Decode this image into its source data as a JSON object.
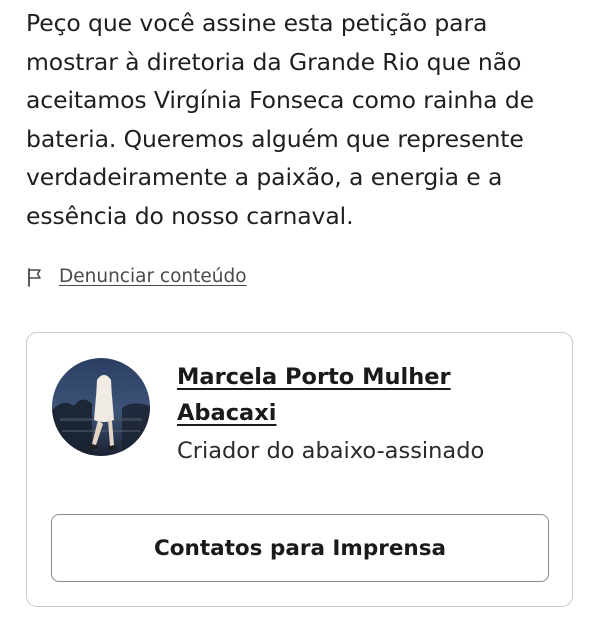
{
  "petition": {
    "body_text": "Peço que você assine esta petição para mostrar à diretoria da Grande Rio que não aceitamos Virgínia Fonseca como rainha de bateria. Queremos alguém que represente verdadeiramente a paixão, a energia e a essência do nosso carnaval."
  },
  "report": {
    "icon": "flag-icon",
    "label": "Denunciar conteúdo"
  },
  "creator": {
    "name": "Marcela Porto Mulher Abacaxi",
    "role": "Criador do abaixo-assinado",
    "avatar": "user-avatar-photo"
  },
  "press_button": {
    "label": "Contatos para Imprensa"
  },
  "colors": {
    "text": "#1f1f1f",
    "muted": "#4a4a4a",
    "card_border": "#c9c9c9",
    "button_border": "#8c8c8c"
  }
}
